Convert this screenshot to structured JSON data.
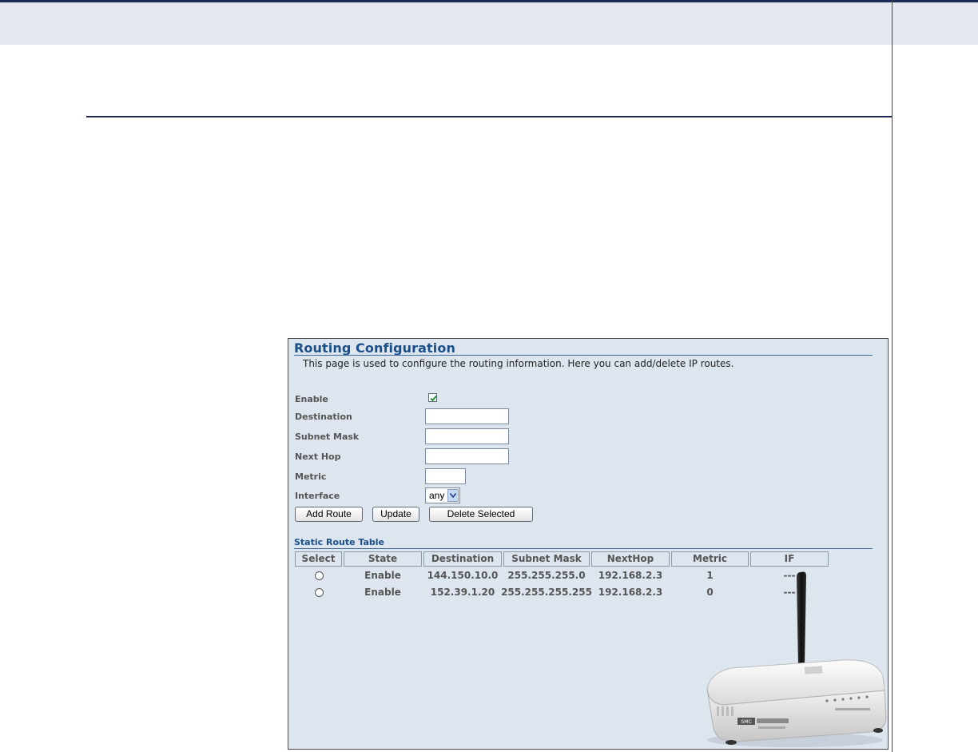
{
  "panel": {
    "title": "Routing Configuration",
    "description": "This page is used to configure the routing information. Here you can add/delete IP routes."
  },
  "form": {
    "enable_label": "Enable",
    "enable_checked": true,
    "destination_label": "Destination",
    "destination_value": "",
    "subnet_mask_label": "Subnet Mask",
    "subnet_mask_value": "",
    "next_hop_label": "Next Hop",
    "next_hop_value": "",
    "metric_label": "Metric",
    "metric_value": "",
    "interface_label": "Interface",
    "interface_selected": "any"
  },
  "buttons": {
    "add_route": "Add Route",
    "update": "Update",
    "delete_selected": "Delete Selected"
  },
  "table": {
    "title": "Static Route Table",
    "headers": [
      "Select",
      "State",
      "Destination",
      "Subnet Mask",
      "NextHop",
      "Metric",
      "IF"
    ],
    "rows": [
      {
        "state": "Enable",
        "destination": "144.150.10.0",
        "subnet_mask": "255.255.255.0",
        "nexthop": "192.168.2.3",
        "metric": "1",
        "if": "---"
      },
      {
        "state": "Enable",
        "destination": "152.39.1.20",
        "subnet_mask": "255.255.255.255",
        "nexthop": "192.168.2.3",
        "metric": "0",
        "if": "---"
      }
    ]
  },
  "image": {
    "icon": "wireless-router-image",
    "brand_text": "SMC"
  },
  "colors": {
    "panel_bg": "#dde5ef",
    "title_color": "#1b4f8a",
    "label_color": "#555555",
    "rule_color": "#1b2a55"
  }
}
